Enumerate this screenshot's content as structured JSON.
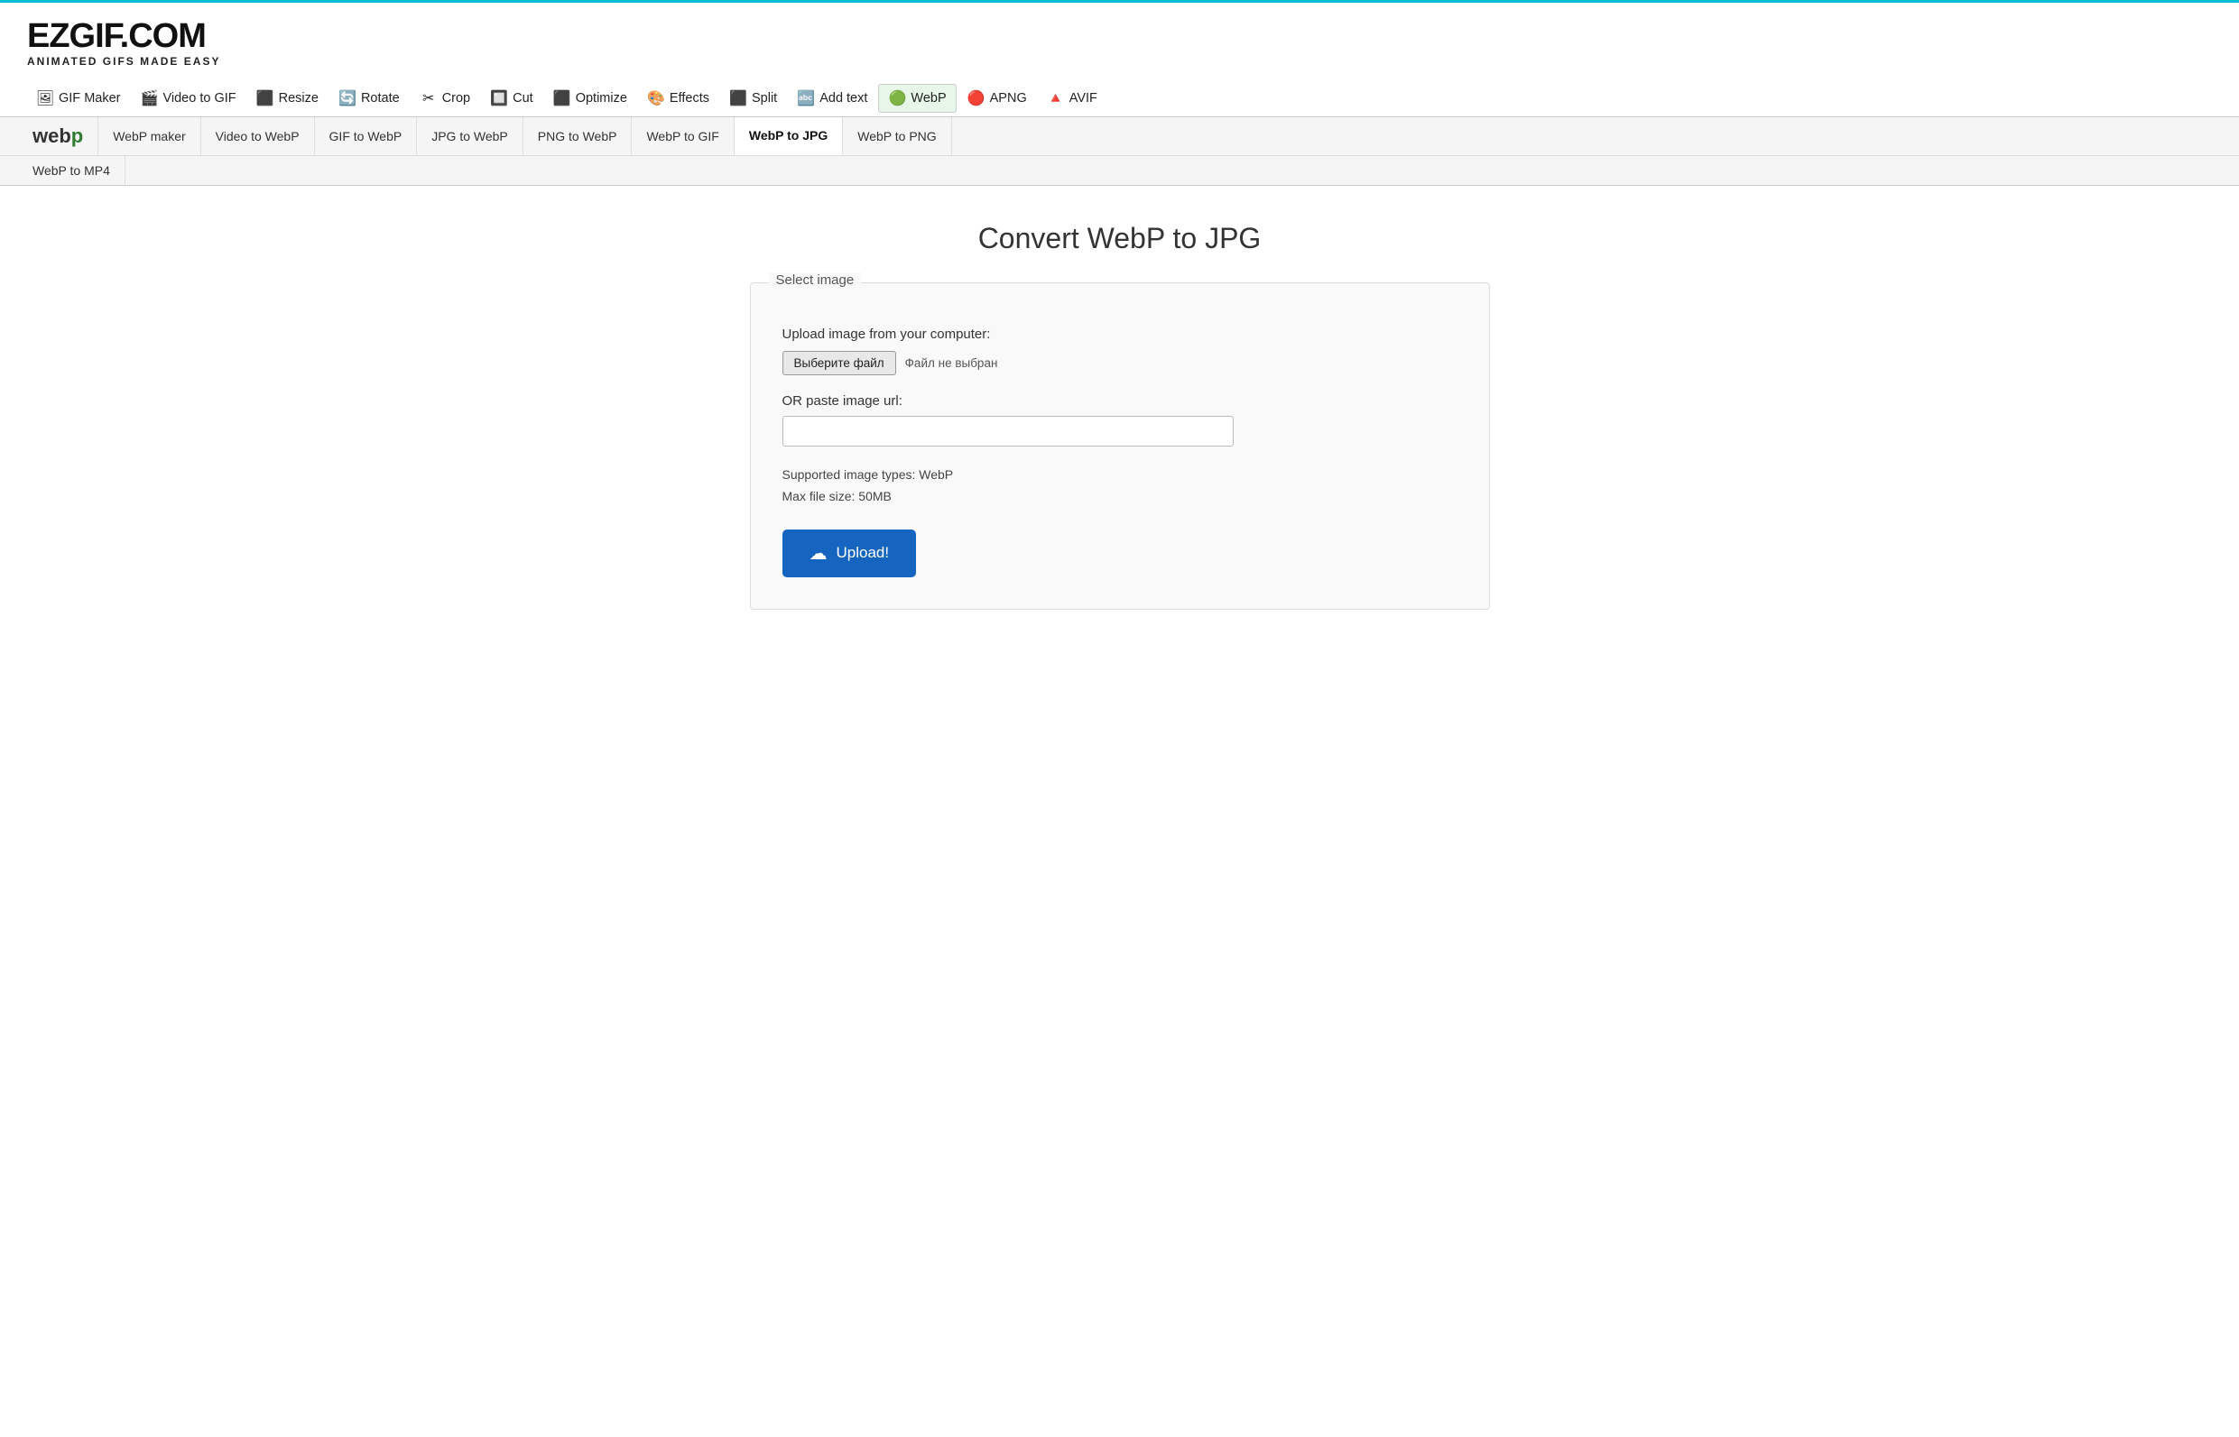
{
  "logo": {
    "main": "EZGIF.COM",
    "sub": "ANIMATED GIFS MADE EASY"
  },
  "top_line_color": "#00bcd4",
  "main_nav": {
    "items": [
      {
        "label": "GIF Maker",
        "icon": "🖼",
        "active": false
      },
      {
        "label": "Video to GIF",
        "icon": "🎬",
        "active": false
      },
      {
        "label": "Resize",
        "icon": "⬛",
        "active": false
      },
      {
        "label": "Rotate",
        "icon": "🔄",
        "active": false
      },
      {
        "label": "Crop",
        "icon": "✂",
        "active": false
      },
      {
        "label": "Cut",
        "icon": "🔲",
        "active": false
      },
      {
        "label": "Optimize",
        "icon": "⬛",
        "active": false
      },
      {
        "label": "Effects",
        "icon": "🎨",
        "active": false
      },
      {
        "label": "Split",
        "icon": "⬛",
        "active": false
      },
      {
        "label": "Add text",
        "icon": "🔤",
        "active": false
      },
      {
        "label": "WebP",
        "icon": "🟢",
        "active": true
      },
      {
        "label": "APNG",
        "icon": "🔴",
        "active": false
      },
      {
        "label": "AVIF",
        "icon": "🔺",
        "active": false
      }
    ]
  },
  "sub_nav": {
    "logo": {
      "web": "web",
      "p": "p"
    },
    "items": [
      {
        "label": "WebP maker",
        "active": false
      },
      {
        "label": "Video to WebP",
        "active": false
      },
      {
        "label": "GIF to WebP",
        "active": false
      },
      {
        "label": "JPG to WebP",
        "active": false
      },
      {
        "label": "PNG to WebP",
        "active": false
      },
      {
        "label": "WebP to GIF",
        "active": false
      },
      {
        "label": "WebP to JPG",
        "active": true
      },
      {
        "label": "WebP to PNG",
        "active": false
      }
    ],
    "row2": [
      {
        "label": "WebP to MP4",
        "active": false
      }
    ]
  },
  "page_title": "Convert WebP to JPG",
  "upload_card": {
    "section_label": "Select image",
    "upload_label": "Upload image from your computer:",
    "file_button_label": "Выберите файл",
    "file_no_chosen": "Файл не выбран",
    "or_label": "OR paste image url:",
    "url_placeholder": "",
    "supported_types": "Supported image types: WebP",
    "max_file_size": "Max file size: 50MB",
    "upload_button_label": "Upload!"
  }
}
